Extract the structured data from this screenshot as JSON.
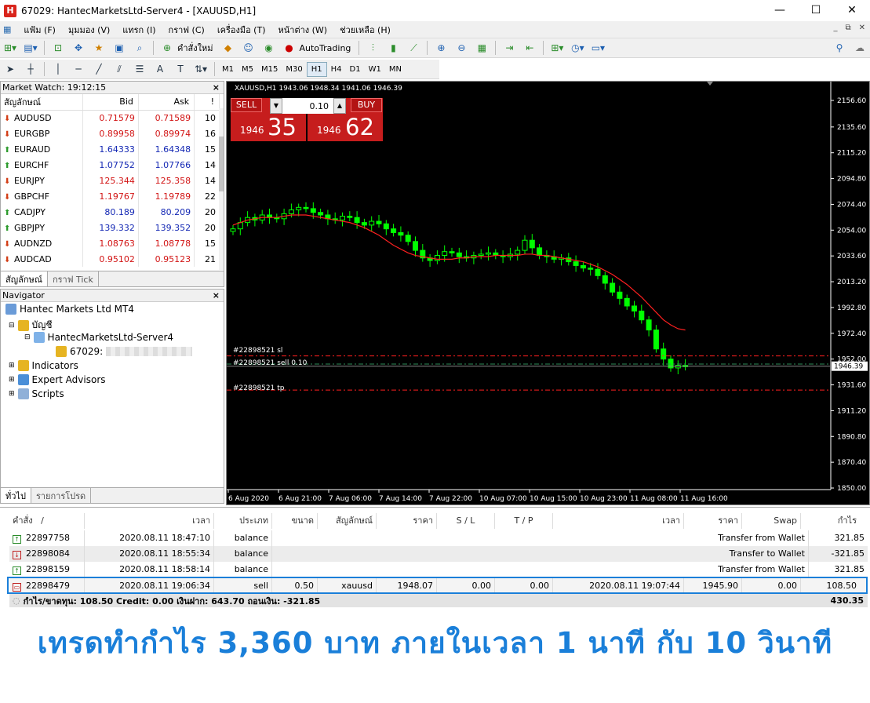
{
  "window": {
    "title": "67029: HantecMarketsLtd-Server4 - [XAUUSD,H1]",
    "app_icon": "H"
  },
  "menu": [
    "แฟ้ม (F)",
    "มุมมอง (V)",
    "แทรก (I)",
    "กราฟ (C)",
    "เครื่องมือ (T)",
    "หน้าต่าง (W)",
    "ช่วยเหลือ (H)"
  ],
  "toolbar": {
    "new_order": "คำสั่งใหม่",
    "autotrading": "AutoTrading"
  },
  "timeframes": [
    "M1",
    "M5",
    "M15",
    "M30",
    "H1",
    "H4",
    "D1",
    "W1",
    "MN"
  ],
  "market_watch": {
    "title": "Market Watch: 19:12:15",
    "headers": {
      "symbol": "สัญลักษณ์",
      "bid": "Bid",
      "ask": "Ask",
      "spread": "!"
    },
    "rows": [
      {
        "symbol": "AUDUSD",
        "bid": "0.71579",
        "ask": "0.71589",
        "spread": "10",
        "dir": "down"
      },
      {
        "symbol": "EURGBP",
        "bid": "0.89958",
        "ask": "0.89974",
        "spread": "16",
        "dir": "down"
      },
      {
        "symbol": "EURAUD",
        "bid": "1.64333",
        "ask": "1.64348",
        "spread": "15",
        "dir": "up"
      },
      {
        "symbol": "EURCHF",
        "bid": "1.07752",
        "ask": "1.07766",
        "spread": "14",
        "dir": "up"
      },
      {
        "symbol": "EURJPY",
        "bid": "125.344",
        "ask": "125.358",
        "spread": "14",
        "dir": "down"
      },
      {
        "symbol": "GBPCHF",
        "bid": "1.19767",
        "ask": "1.19789",
        "spread": "22",
        "dir": "down"
      },
      {
        "symbol": "CADJPY",
        "bid": "80.189",
        "ask": "80.209",
        "spread": "20",
        "dir": "up"
      },
      {
        "symbol": "GBPJPY",
        "bid": "139.332",
        "ask": "139.352",
        "spread": "20",
        "dir": "up"
      },
      {
        "symbol": "AUDNZD",
        "bid": "1.08763",
        "ask": "1.08778",
        "spread": "15",
        "dir": "down"
      },
      {
        "symbol": "AUDCAD",
        "bid": "0.95102",
        "ask": "0.95123",
        "spread": "21",
        "dir": "down"
      }
    ],
    "tabs": [
      "สัญลักษณ์",
      "กราฟ Tick"
    ]
  },
  "navigator": {
    "title": "Navigator",
    "root": "Hantec Markets Ltd MT4",
    "accounts": "บัญชี",
    "server": "HantecMarketsLtd-Server4",
    "account_id": "67029:",
    "items": [
      "Indicators",
      "Expert Advisors",
      "Scripts"
    ],
    "tabs": [
      "ทั่วไป",
      "รายการโปรด"
    ]
  },
  "chart": {
    "info": "XAUUSD,H1  1943.06 1948.34 1941.06 1946.39",
    "sell_label": "SELL",
    "buy_label": "BUY",
    "lot": "0.10",
    "sell_small": "1946",
    "sell_big": "35",
    "buy_small": "1946",
    "buy_big": "62",
    "current_price": "1946.39",
    "order_sl": "#22898521 sl",
    "order_entry": "#22898521 sell 0.10",
    "order_tp": "#22898521 tp",
    "colors": {
      "bull": "#00ff00",
      "bear": "#00ff00",
      "ma": "#ff2020",
      "sl_tp": "#ff2020"
    }
  },
  "chart_data": {
    "type": "line",
    "title": "XAUUSD,H1",
    "y_ticks": [
      "2156.60",
      "2135.60",
      "2115.20",
      "2094.80",
      "2074.40",
      "2054.00",
      "2033.60",
      "2013.20",
      "1992.80",
      "1972.40",
      "1952.00",
      "1931.60",
      "1911.20",
      "1890.80",
      "1870.40",
      "1850.00"
    ],
    "x_ticks": [
      "6 Aug 2020",
      "6 Aug 21:00",
      "7 Aug 06:00",
      "7 Aug 14:00",
      "7 Aug 22:00",
      "10 Aug 07:00",
      "10 Aug 15:00",
      "10 Aug 23:00",
      "11 Aug 08:00",
      "11 Aug 16:00"
    ],
    "ylim": [
      1850.0,
      2156.6
    ],
    "close": [
      2055,
      2060,
      2064,
      2062,
      2066,
      2064,
      2063,
      2067,
      2070,
      2072,
      2071,
      2068,
      2066,
      2063,
      2062,
      2065,
      2064,
      2060,
      2058,
      2061,
      2059,
      2055,
      2052,
      2050,
      2045,
      2038,
      2032,
      2030,
      2034,
      2037,
      2036,
      2033,
      2032,
      2034,
      2035,
      2036,
      2034,
      2033,
      2035,
      2038,
      2046,
      2040,
      2034,
      2033,
      2031,
      2032,
      2029,
      2026,
      2024,
      2023,
      2018,
      2012,
      2005,
      2000,
      1994,
      1990,
      1983,
      1975,
      1960,
      1952,
      1945,
      1947,
      1946
    ],
    "ma": [
      2058,
      2060,
      2062,
      2063,
      2064,
      2064,
      2064,
      2065,
      2066,
      2066,
      2066,
      2065,
      2064,
      2063,
      2062,
      2061,
      2060,
      2058,
      2056,
      2053,
      2050,
      2046,
      2042,
      2039,
      2036,
      2034,
      2033,
      2032,
      2031,
      2031,
      2031,
      2032,
      2032,
      2033,
      2033,
      2033,
      2034,
      2034,
      2034,
      2034,
      2035,
      2035,
      2034,
      2034,
      2033,
      2032,
      2031,
      2030,
      2029,
      2027,
      2025,
      2022,
      2019,
      2015,
      2011,
      2006,
      2001,
      1995,
      1989,
      1983,
      1979,
      1976,
      1975
    ],
    "sl": 1954.5,
    "entry": 1948.07,
    "tp": 1927.5
  },
  "terminal": {
    "headers": {
      "order": "คำสั่ง",
      "sort": "/",
      "time": "เวลา",
      "type": "ประเภท",
      "size": "ขนาด",
      "symbol": "สัญลักษณ์",
      "price": "ราคา",
      "sl": "S / L",
      "tp": "T / P",
      "close_time": "เวลา",
      "close_price": "ราคา",
      "swap": "Swap",
      "profit": "กำไร"
    },
    "rows": [
      {
        "order": "22897758",
        "time": "2020.08.11 18:47:10",
        "type": "balance",
        "comment": "Transfer from Wallet",
        "profit": "321.85",
        "dir": "up"
      },
      {
        "order": "22898084",
        "time": "2020.08.11 18:55:34",
        "type": "balance",
        "comment": "Transfer to Wallet",
        "profit": "-321.85",
        "dir": "down"
      },
      {
        "order": "22898159",
        "time": "2020.08.11 18:58:14",
        "type": "balance",
        "comment": "Transfer from Wallet",
        "profit": "321.85",
        "dir": "up"
      }
    ],
    "trade": {
      "order": "22898479",
      "time": "2020.08.11 19:06:34",
      "type": "sell",
      "size": "0.50",
      "symbol": "xauusd",
      "price": "1948.07",
      "sl": "0.00",
      "tp": "0.00",
      "close_time": "2020.08.11 19:07:44",
      "close_price": "1945.90",
      "swap": "0.00",
      "profit": "108.50"
    },
    "summary": "กำไร/ขาดทุน: 108.50  Credit: 0.00  เงินฝาก: 643.70  ถอนเงิน: -321.85",
    "summary_total": "430.35"
  },
  "caption": "เทรดทำกำไร  3,360 บาท ภายในเวลา 1 นาที กับ 10 วินาที"
}
